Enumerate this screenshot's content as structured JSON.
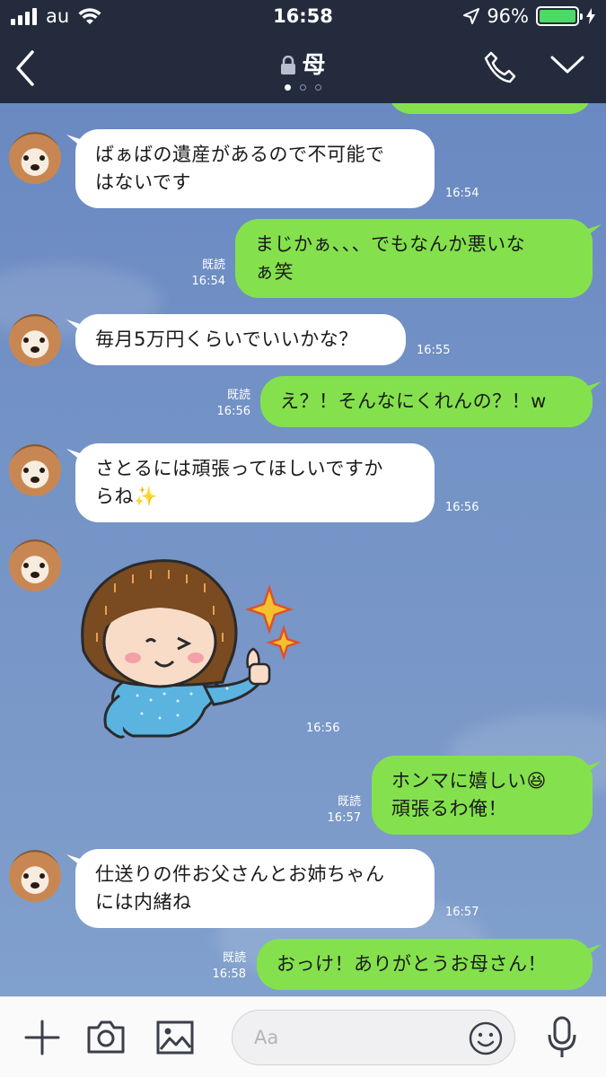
{
  "status_bar": {
    "carrier": "au",
    "time": "16:58",
    "battery": "96%"
  },
  "header": {
    "title": "母"
  },
  "messages": [
    {
      "side": "left",
      "text": "ばぁばの遺産があるので不可能ではないです",
      "line1": "ばぁばの遺産があるので不可能で",
      "line2": "はないです",
      "time": "16:54"
    },
    {
      "side": "right",
      "line1": "まじかぁ、、、でもなんか悪いな",
      "line2": "ぁ笑",
      "read": "既読",
      "time": "16:54"
    },
    {
      "side": "left",
      "text": "毎月5万円くらいでいいかな？",
      "time": "16:55"
    },
    {
      "side": "right",
      "text": "え？！そんなにくれんの？！w",
      "read": "既読",
      "time": "16:56"
    },
    {
      "side": "left",
      "line1": "さとるには頑張ってほしいですか",
      "line2": "らね✨",
      "time": "16:56"
    },
    {
      "side": "left",
      "type": "sticker",
      "time": "16:56"
    },
    {
      "side": "right",
      "line1": "ホンマに嬉しい😆",
      "line2": "頑張るわ俺！",
      "read": "既読",
      "time": "16:57"
    },
    {
      "side": "left",
      "line1": "仕送りの件お父さんとお姉ちゃん",
      "line2": "には内緒ね",
      "time": "16:57"
    },
    {
      "side": "right",
      "text": "おっけ！ありがとうお母さん！",
      "read": "既読",
      "time": "16:58"
    }
  ],
  "input": {
    "placeholder": "Aa"
  },
  "colors": {
    "header": "#232b3d",
    "sent_bubble": "#84e14d",
    "received_bubble": "#ffffff",
    "chat_bg": "#6f8cbf"
  }
}
